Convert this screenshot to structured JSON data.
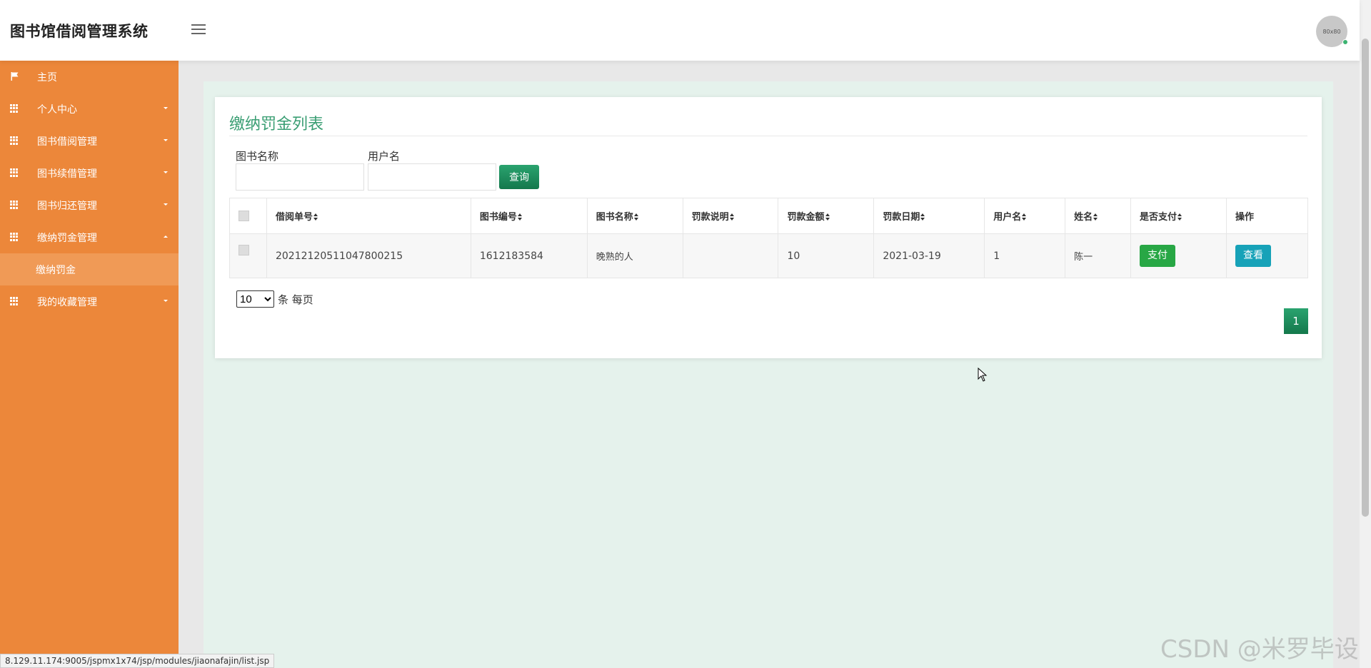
{
  "app": {
    "title": "图书馆借阅管理系统",
    "avatar_text": "80x80"
  },
  "sidebar": {
    "items": [
      {
        "label": "主页",
        "icon": "flag-icon"
      },
      {
        "label": "个人中心",
        "icon": "grid-icon"
      },
      {
        "label": "图书借阅管理",
        "icon": "grid-icon"
      },
      {
        "label": "图书续借管理",
        "icon": "grid-icon"
      },
      {
        "label": "图书归还管理",
        "icon": "grid-icon"
      },
      {
        "label": "缴纳罚金管理",
        "icon": "grid-icon",
        "expanded": true
      },
      {
        "label": "我的收藏管理",
        "icon": "grid-icon"
      }
    ],
    "sub_item": "缴纳罚金"
  },
  "page": {
    "title": "缴纳罚金列表",
    "filters": {
      "book_name_label": "图书名称",
      "username_label": "用户名",
      "query_button": "查询"
    },
    "table": {
      "headers": [
        "借阅单号",
        "图书编号",
        "图书名称",
        "罚款说明",
        "罚款金额",
        "罚款日期",
        "用户名",
        "姓名",
        "是否支付",
        "操作"
      ],
      "rows": [
        {
          "borrow_no": "20212120511047800215",
          "book_no": "1612183584",
          "book_name": "晚熟的人",
          "fine_desc": "",
          "fine_amount": "10",
          "fine_date": "2021-03-19",
          "username": "1",
          "name": "陈一",
          "pay_button": "支付",
          "view_button": "查看"
        }
      ]
    },
    "pagination": {
      "page_size": "10",
      "per_page_text": "条 每页",
      "current_page": "1"
    }
  },
  "status_url": "8.129.11.174:9005/jspmx1x74/jsp/modules/jiaonafajin/list.jsp",
  "watermark": "CSDN @米罗毕设",
  "colors": {
    "sidebar": "#ec873a",
    "accent_green": "#1e8e5e",
    "title_green": "#3a9e73",
    "pay": "#28a745",
    "view": "#17a2b8"
  }
}
